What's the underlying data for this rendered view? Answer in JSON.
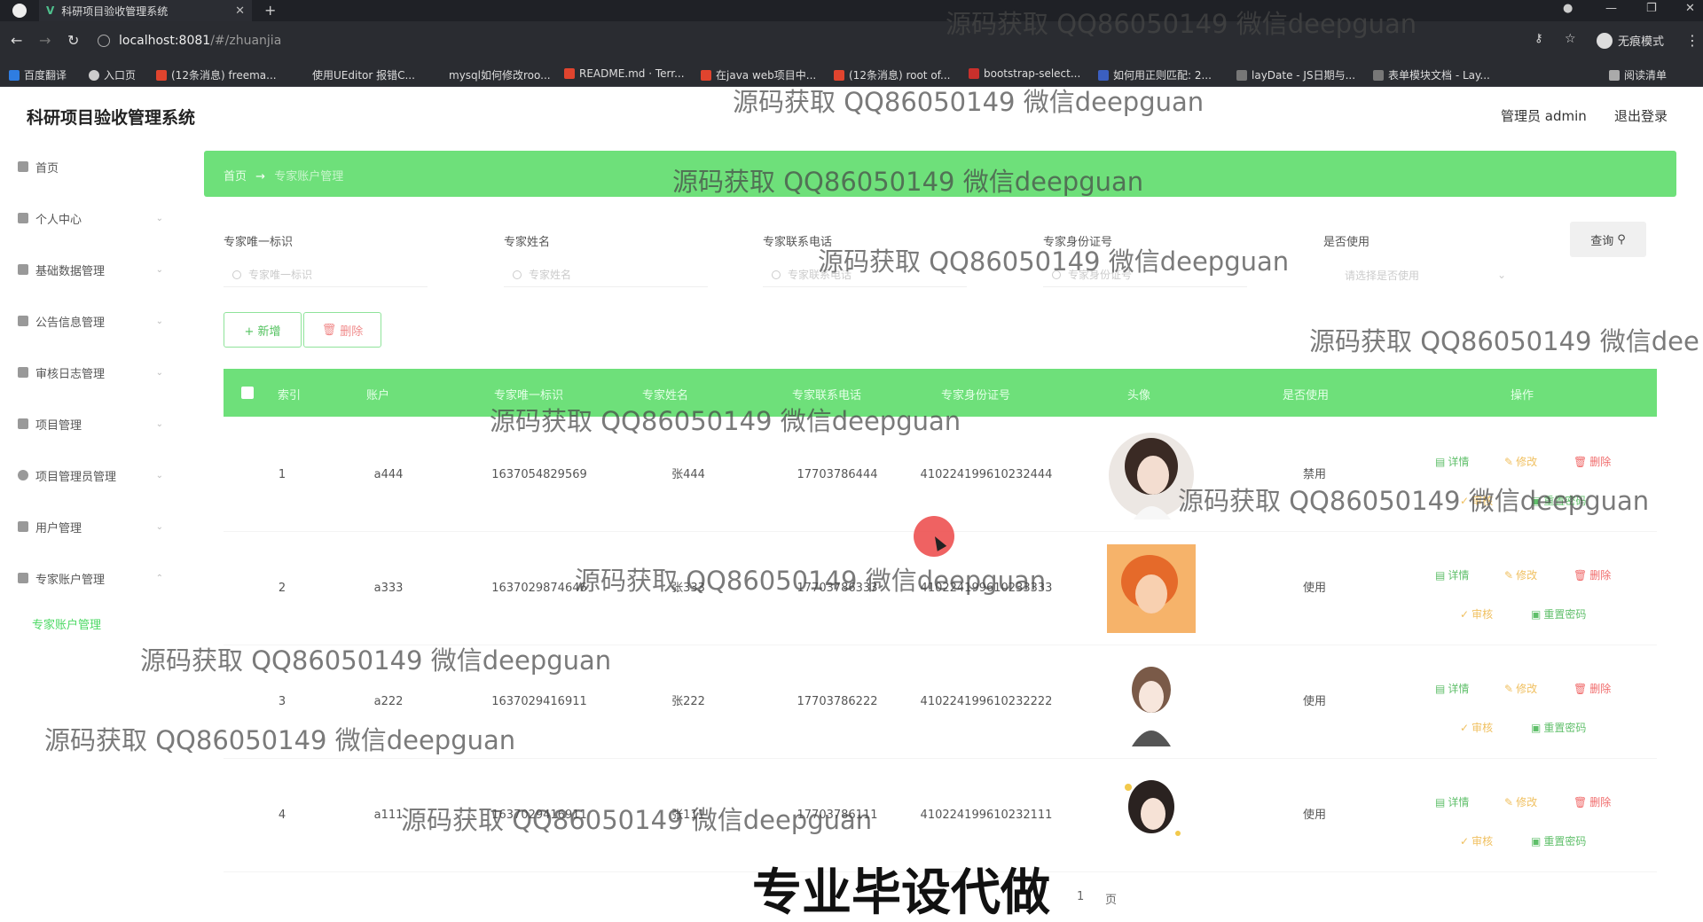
{
  "browser": {
    "tab_title": "科研项目验收管理系统",
    "tab_favicon": "V",
    "url_host": "localhost:8081",
    "url_path": "/#/zhuanjia",
    "incognito_label": "无痕模式",
    "reading_list": "阅读清单",
    "bookmarks": [
      "百度翻译",
      "入口页",
      "(12条消息) freema...",
      "使用UEditor 报错C...",
      "mysql如何修改roo...",
      "README.md · Terr...",
      "在java web项目中...",
      "(12条消息) root of...",
      "bootstrap-select...",
      "如何用正则匹配: 2...",
      "layDate - JS日期与...",
      "表单模块文档 - Lay..."
    ]
  },
  "app": {
    "title": "科研项目验收管理系统",
    "admin_label": "管理员 admin",
    "logout_label": "退出登录"
  },
  "sidebar": {
    "items": [
      {
        "label": "首页",
        "icon": "home-icon"
      },
      {
        "label": "个人中心",
        "icon": "user-icon"
      },
      {
        "label": "基础数据管理",
        "icon": "grid-icon"
      },
      {
        "label": "公告信息管理",
        "icon": "list-icon"
      },
      {
        "label": "审核日志管理",
        "icon": "log-icon"
      },
      {
        "label": "项目管理",
        "icon": "menu-icon"
      },
      {
        "label": "项目管理员管理",
        "icon": "circle-icon"
      },
      {
        "label": "用户管理",
        "icon": "users-icon"
      },
      {
        "label": "专家账户管理",
        "icon": "mail-icon"
      }
    ],
    "active_sub": "专家账户管理"
  },
  "breadcrumb": {
    "home": "首页",
    "arrow": "→",
    "current": "专家账户管理"
  },
  "search": {
    "labels": [
      "专家唯一标识",
      "专家姓名",
      "专家联系电话",
      "专家身份证号",
      "是否使用"
    ],
    "placeholders": [
      "专家唯一标识",
      "专家姓名",
      "专家联系电话",
      "专家身份证号"
    ],
    "select_placeholder": "请选择是否使用",
    "query_label": "查询"
  },
  "toolbar": {
    "add_label": "+ 新增",
    "delete_label": "删除"
  },
  "table": {
    "headers": [
      "索引",
      "账户",
      "专家唯一标识",
      "专家姓名",
      "专家联系电话",
      "专家身份证号",
      "头像",
      "是否使用",
      "操作"
    ],
    "rows": [
      {
        "index": "1",
        "account": "a444",
        "uid": "1637054829569",
        "name": "张444",
        "phone": "17703786444",
        "idcard": "410224199610232444",
        "status": "禁用"
      },
      {
        "index": "2",
        "account": "a333",
        "uid": "1637029874646",
        "name": "张333",
        "phone": "17703786333",
        "idcard": "410224199610233333",
        "status": "使用"
      },
      {
        "index": "3",
        "account": "a222",
        "uid": "1637029416911",
        "name": "张222",
        "phone": "17703786222",
        "idcard": "410224199610232222",
        "status": "使用"
      },
      {
        "index": "4",
        "account": "a111",
        "uid": "1637029416911",
        "name": "张111",
        "phone": "17703786111",
        "idcard": "410224199610232111",
        "status": "使用"
      }
    ],
    "actions": {
      "detail": "详情",
      "edit": "修改",
      "remove": "删除",
      "review": "审核",
      "reset": "重置密码"
    }
  },
  "pager": {
    "page": "1",
    "unit": "页"
  },
  "watermarks": {
    "text": "源码获取 QQ86050149 微信deepguan",
    "text_cut": "源码获取 QQ86050149 微信dee",
    "big": "专业毕设代做"
  }
}
